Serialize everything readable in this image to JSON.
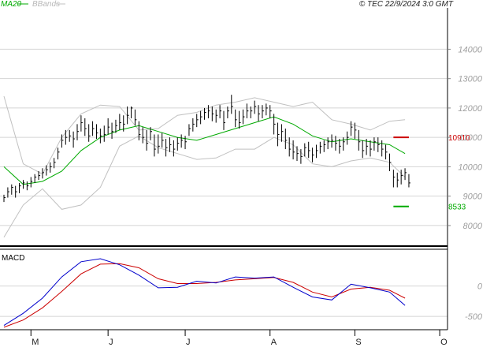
{
  "header": {
    "legend": [
      {
        "label": "MA20",
        "color": "#00aa00"
      },
      {
        "label": "BBands",
        "color": "#b8b8b8"
      }
    ],
    "copyright": "© TEC 22/9/2024 3:0 GMT"
  },
  "colors": {
    "price_bar": "#000000",
    "ma20": "#00aa00",
    "bbands": "#c0c0c0",
    "resistance": "#cc0000",
    "support": "#00aa00",
    "macd": "#0000cc",
    "signal": "#cc0000",
    "grid": "#d4d4d4",
    "axis_text": "#a0a0a0"
  },
  "chart_data": [
    {
      "type": "ohlc",
      "ylim": [
        7300,
        15300
      ],
      "yticks": [
        8000,
        9000,
        10000,
        11000,
        12000,
        13000,
        14000
      ],
      "ytick_labels": [
        "8000",
        "9000",
        "10000",
        "11000",
        "12000",
        "13000",
        "14000"
      ],
      "x_months": [
        {
          "label": "M",
          "bar": 7
        },
        {
          "label": "J",
          "bar": 27
        },
        {
          "label": "J",
          "bar": 47
        },
        {
          "label": "A",
          "bar": 69
        },
        {
          "label": "S",
          "bar": 91
        },
        {
          "label": "O",
          "bar": 113
        }
      ],
      "x_range": [
        0,
        114
      ],
      "close": [
        8950,
        9150,
        9300,
        9150,
        9350,
        9450,
        9350,
        9500,
        9650,
        9700,
        9800,
        9900,
        10000,
        10150,
        10500,
        10900,
        11000,
        11050,
        10950,
        11200,
        11500,
        11300,
        11050,
        11300,
        11150,
        11050,
        11100,
        11350,
        11200,
        11400,
        11500,
        11450,
        11750,
        12000,
        11600,
        11100,
        11000,
        10800,
        11200,
        10600,
        10700,
        10900,
        10650,
        10750,
        10600,
        10800,
        10900,
        10850,
        11300,
        11450,
        11600,
        11700,
        11850,
        11900,
        11800,
        11750,
        11900,
        11500,
        11900,
        12050,
        11600,
        11500,
        11700,
        11900,
        11900,
        12050,
        11800,
        11900,
        12000,
        11900,
        11450,
        11100,
        11200,
        10900,
        10600,
        10500,
        10450,
        10350,
        10650,
        10550,
        10400,
        10550,
        10700,
        10750,
        10850,
        10900,
        10800,
        10700,
        10850,
        11000,
        11350,
        11250,
        10850,
        10550,
        10700,
        10600,
        10850,
        10750,
        10600,
        10500,
        10150,
        9650,
        9550,
        9700,
        9800,
        9450
      ],
      "high": [
        9050,
        9300,
        9400,
        9350,
        9450,
        9550,
        9500,
        9650,
        9750,
        9850,
        9950,
        10050,
        10150,
        10300,
        10650,
        11100,
        11250,
        11250,
        11200,
        11450,
        11750,
        11650,
        11450,
        11550,
        11450,
        11300,
        11400,
        11650,
        11500,
        11600,
        11800,
        11750,
        12050,
        12050,
        11950,
        11550,
        11350,
        11250,
        11350,
        11100,
        11100,
        11150,
        10950,
        11000,
        10900,
        11000,
        11100,
        11050,
        11450,
        11650,
        11800,
        11900,
        12000,
        12100,
        12050,
        11950,
        12100,
        11900,
        12050,
        12450,
        11950,
        11900,
        11950,
        12150,
        12050,
        12250,
        12100,
        12100,
        12150,
        12100,
        11800,
        11500,
        11450,
        11300,
        11000,
        10900,
        10700,
        10600,
        10800,
        10850,
        10650,
        10750,
        10850,
        10900,
        11000,
        11100,
        11050,
        10950,
        11000,
        11200,
        11550,
        11500,
        11250,
        10900,
        10950,
        10900,
        11000,
        11000,
        10900,
        10750,
        10450,
        9900,
        9800,
        9900,
        9950,
        9750
      ],
      "low": [
        8800,
        8950,
        9050,
        8950,
        9100,
        9250,
        9200,
        9300,
        9450,
        9550,
        9600,
        9700,
        9800,
        9950,
        10250,
        10650,
        10750,
        10850,
        10650,
        10900,
        11200,
        11050,
        10850,
        11050,
        10950,
        10800,
        10850,
        11100,
        10950,
        11150,
        11250,
        11200,
        11450,
        11650,
        11400,
        10900,
        10800,
        10550,
        10900,
        10350,
        10450,
        10650,
        10350,
        10500,
        10350,
        10550,
        10650,
        10600,
        11050,
        11200,
        11350,
        11450,
        11600,
        11650,
        11550,
        11500,
        11650,
        11250,
        11650,
        11800,
        11350,
        11300,
        11450,
        11650,
        11650,
        11800,
        11550,
        11650,
        11750,
        11650,
        11100,
        10700,
        10850,
        10600,
        10350,
        10250,
        10200,
        10100,
        10350,
        10300,
        10150,
        10300,
        10450,
        10500,
        10600,
        10650,
        10550,
        10450,
        10550,
        10750,
        11050,
        10950,
        10550,
        10300,
        10400,
        10350,
        10550,
        10500,
        10350,
        10250,
        9850,
        9300,
        9300,
        9400,
        9550,
        9300
      ]
    },
    {
      "type": "line",
      "series": [
        {
          "name": "MA20",
          "color": "#00aa00",
          "x": [
            0,
            5,
            10,
            15,
            20,
            25,
            30,
            35,
            40,
            45,
            50,
            55,
            60,
            65,
            70,
            75,
            80,
            85,
            90,
            95,
            100,
            104
          ],
          "values": [
            10000,
            9400,
            9500,
            9850,
            10550,
            11000,
            11250,
            11400,
            11200,
            11000,
            10900,
            11100,
            11300,
            11500,
            11700,
            11450,
            11050,
            10850,
            10950,
            10850,
            10750,
            10450
          ]
        },
        {
          "name": "BBands",
          "color": "#c0c0c0",
          "x": [
            0,
            5,
            10,
            15,
            20,
            25,
            30,
            35,
            40,
            45,
            50,
            55,
            60,
            65,
            70,
            75,
            80,
            85,
            90,
            95,
            100,
            104
          ],
          "values": [
            12400,
            10100,
            9750,
            11000,
            11800,
            12100,
            12050,
            11250,
            11300,
            11750,
            11850,
            12100,
            12200,
            12350,
            12200,
            12050,
            12200,
            11600,
            11450,
            11250,
            11550,
            11600
          ]
        },
        {
          "name": "BBands",
          "color": "#c0c0c0",
          "x": [
            0,
            5,
            10,
            15,
            20,
            25,
            30,
            35,
            40,
            45,
            50,
            55,
            60,
            65,
            70,
            75,
            80,
            85,
            90,
            95,
            100,
            104
          ],
          "values": [
            7600,
            8700,
            9250,
            8550,
            8700,
            9300,
            10700,
            11050,
            10650,
            10450,
            10250,
            10300,
            10600,
            10600,
            11000,
            10750,
            10100,
            10000,
            10200,
            10300,
            10150,
            9650
          ]
        }
      ]
    },
    {
      "type": "hline",
      "lines": [
        {
          "label": "10910",
          "value": 11000,
          "color": "#cc0000",
          "x_from": 101,
          "x_to": 105
        },
        {
          "label": "8533",
          "value": 8650,
          "color": "#00aa00",
          "x_from": 101,
          "x_to": 105
        }
      ]
    },
    {
      "type": "line",
      "title": "MACD",
      "ylim": [
        -720,
        580
      ],
      "yticks": [
        0,
        -500
      ],
      "ytick_labels": [
        "0",
        "-500"
      ],
      "series": [
        {
          "name": "MACD",
          "color": "#0000cc",
          "x": [
            0,
            5,
            10,
            15,
            20,
            25,
            30,
            35,
            40,
            45,
            50,
            55,
            60,
            65,
            70,
            75,
            80,
            85,
            90,
            95,
            100,
            104
          ],
          "values": [
            -650,
            -450,
            -200,
            150,
            400,
            450,
            350,
            180,
            -30,
            -20,
            80,
            50,
            150,
            130,
            150,
            -20,
            -180,
            -230,
            30,
            -30,
            -100,
            -320
          ]
        },
        {
          "name": "Signal",
          "color": "#cc0000",
          "x": [
            0,
            5,
            10,
            15,
            20,
            25,
            30,
            35,
            40,
            45,
            50,
            55,
            60,
            65,
            70,
            75,
            80,
            85,
            90,
            95,
            100,
            104
          ],
          "values": [
            -680,
            -560,
            -360,
            -90,
            200,
            360,
            370,
            300,
            120,
            40,
            40,
            60,
            100,
            120,
            140,
            60,
            -100,
            -180,
            -50,
            -20,
            -70,
            -200
          ]
        }
      ]
    }
  ]
}
